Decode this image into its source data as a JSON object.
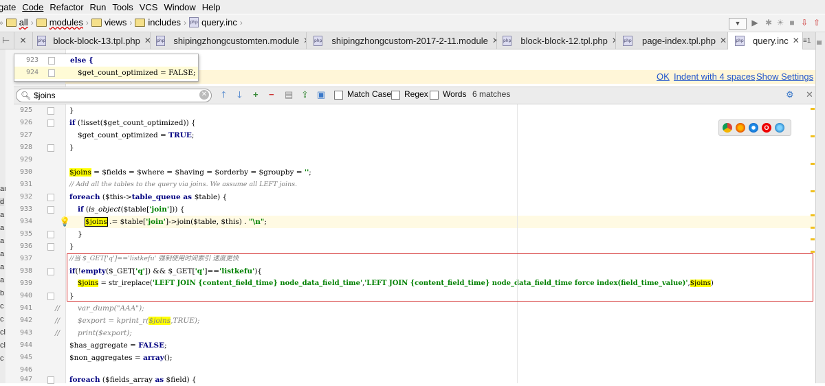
{
  "menu": [
    "gate",
    "Code",
    "Refactor",
    "Run",
    "Tools",
    "VCS",
    "Window",
    "Help"
  ],
  "breadcrumb": [
    "all",
    "modules",
    "views",
    "includes",
    "query.inc"
  ],
  "tabs": [
    {
      "label": "block-block-13.tpl.php",
      "active": false
    },
    {
      "label": "shipingzhongcustomten.module",
      "active": false
    },
    {
      "label": "shipingzhongcustom-2017-2-11.module",
      "active": false
    },
    {
      "label": "block-block-12.tpl.php",
      "active": false
    },
    {
      "label": "page-index.tpl.php",
      "active": false
    },
    {
      "label": "query.inc",
      "active": true
    }
  ],
  "tab_overflow": "≡1",
  "popup_lines": [
    {
      "num": "923",
      "code": "else {"
    },
    {
      "num": "924",
      "code": "$get_count_optimized = FALSE;"
    }
  ],
  "notification": {
    "ok": "OK",
    "indent": "Indent with 4 spaces",
    "settings": "Show Settings"
  },
  "search": {
    "value": "$joins",
    "match_case": "Match Case",
    "regex": "Regex",
    "words": "Words",
    "matches": "6 matches"
  },
  "code_lines": [
    {
      "num": "925"
    },
    {
      "num": "926"
    },
    {
      "num": "927"
    },
    {
      "num": "928"
    },
    {
      "num": "929"
    },
    {
      "num": "930"
    },
    {
      "num": "931"
    },
    {
      "num": "932"
    },
    {
      "num": "933"
    },
    {
      "num": "934"
    },
    {
      "num": "935"
    },
    {
      "num": "936"
    },
    {
      "num": "937"
    },
    {
      "num": "938"
    },
    {
      "num": "939"
    },
    {
      "num": "940"
    },
    {
      "num": "941"
    },
    {
      "num": "942"
    },
    {
      "num": "943"
    },
    {
      "num": "944"
    },
    {
      "num": "945"
    },
    {
      "num": "946"
    },
    {
      "num": "947"
    }
  ],
  "code_text": {
    "l925": "}",
    "l926_kw": "if",
    "l926_rest": " (!isset($get_count_optimized)) {",
    "l927_a": "$get_count_optimized",
    "l927_b": " = ",
    "l927_c": "TRUE",
    "l927_d": ";",
    "l928": "}",
    "l930_a": "$joins",
    "l930_b": " = $fields = $where = $having = $orderby = $groupby = ",
    "l930_c": "''",
    "l930_d": ";",
    "l931": "// Add all the tables to the query via joins. We assume all LEFT joins.",
    "l932_kw": "foreach",
    "l932_a": " ($this->",
    "l932_b": "table_queue",
    "l932_c": " as ",
    "l932_d": "$table) {",
    "l933_kw": "if",
    "l933_a": " (",
    "l933_fn": "is_object",
    "l933_b": "($table[",
    "l933_c": "'join'",
    "l933_d": "])) {",
    "l934_a": "$joins",
    "l934_b": " .= $table[",
    "l934_c": "'join'",
    "l934_d": "]->join($table, $this) . ",
    "l934_e": "\"\\n\"",
    "l934_f": ";",
    "l935": "}",
    "l936": "}",
    "l937": "//当 $_GET['q']=='listkefu' 强制使用时间索引 速度更快",
    "l938_kw": "if",
    "l938_a": "(!",
    "l938_kw2": "empty",
    "l938_b": "($_GET[",
    "l938_c": "'q'",
    "l938_d": "]) && $_GET[",
    "l938_e": "'q'",
    "l938_f": "]==",
    "l938_g": "'listkefu'",
    "l938_h": "){",
    "l939_a": "$joins",
    "l939_b": " = str_ireplace(",
    "l939_c": "'LEFT JOIN {content_field_time} node_data_field_time'",
    "l939_d": ",",
    "l939_e": "'LEFT JOIN {content_field_time} node_data_field_time force index(field_time_value)'",
    "l939_f": ",",
    "l939_g": "$joins",
    "l939_h": ")",
    "l940": "}",
    "l941": "var_dump(\"AAA\");",
    "l942_a": "$export = kprint_r(",
    "l942_b": "$joins",
    "l942_c": ",TRUE);",
    "l943": "print($export);",
    "l944_a": "$has_aggregate",
    "l944_b": " = ",
    "l944_c": "FALSE",
    "l944_d": ";",
    "l945_a": "$non_aggregates",
    "l945_b": " = ",
    "l945_c": "array",
    "l945_d": "();",
    "l947_kw": "foreach",
    "l947_a": " ($fields_array ",
    "l947_kw2": "as",
    "l947_b": " $field) {",
    "comment_slash": "//"
  },
  "left_edge_chars": [
    "ar",
    "d",
    "a",
    "a",
    "a",
    "a",
    "a",
    "a",
    "b",
    "c",
    "c",
    "cl",
    "cl",
    "c"
  ],
  "colors": {
    "keyword": "#000080",
    "string": "#008000",
    "variable": "#660e7a",
    "comment": "#808080",
    "highlight": "#ffff00",
    "box": "#d22a2a"
  }
}
